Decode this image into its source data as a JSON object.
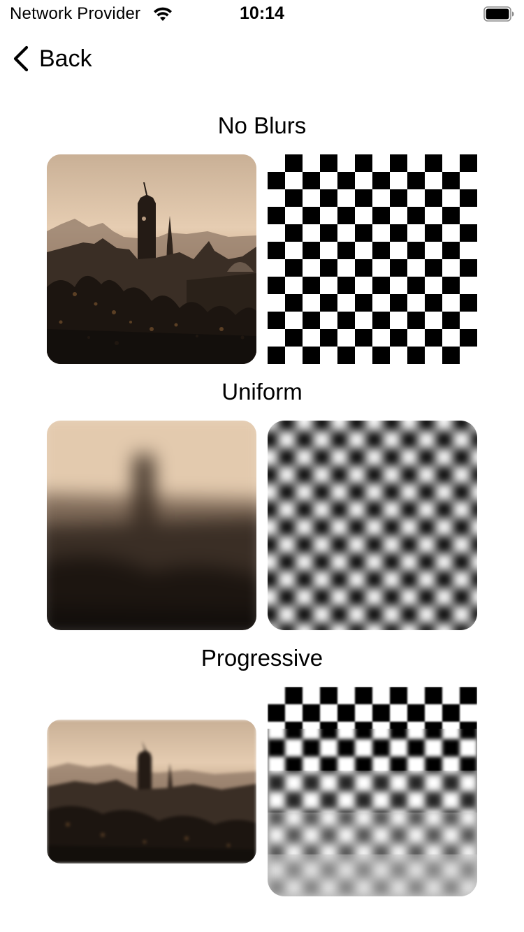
{
  "status_bar": {
    "carrier": "Network Provider",
    "time": "10:14"
  },
  "nav": {
    "back_label": "Back"
  },
  "sections": [
    {
      "title": "No Blurs"
    },
    {
      "title": "Uniform"
    },
    {
      "title": "Progressive"
    }
  ],
  "colors": {
    "background": "#ffffff",
    "text": "#000000"
  },
  "icons": {
    "wifi": "wifi-icon",
    "battery": "battery-icon",
    "back": "chevron-left-icon"
  }
}
